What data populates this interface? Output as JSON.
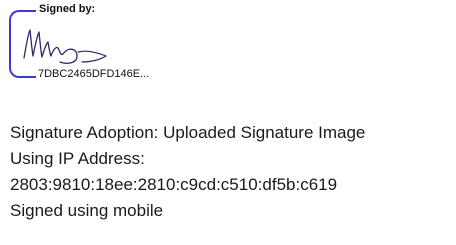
{
  "signature_block": {
    "signed_by_label": "Signed by:",
    "envelope_id": "7DBC2465DFD146E...",
    "accent_color": "#3d3ad1"
  },
  "details": {
    "adoption": "Signature Adoption: Uploaded Signature Image",
    "ip_label": "Using IP Address:",
    "ip_address": "2803:9810:18ee:2810:c9cd:c510:df5b:c619",
    "signed_method": "Signed using mobile"
  }
}
